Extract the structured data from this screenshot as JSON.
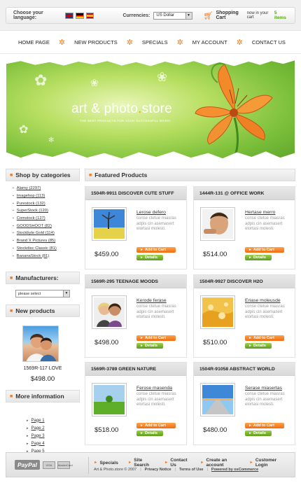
{
  "topbar": {
    "language_label": "Choose your language:",
    "languages": [
      "english-flag",
      "german-flag",
      "spanish-flag"
    ],
    "currency_label": "Currencies:",
    "currency_value": "US Dollar",
    "cart_label": "Shopping Cart",
    "cart_text": "now in your cart",
    "cart_count": "5 items"
  },
  "nav": {
    "items": [
      "HOME PAGE",
      "NEW PRODUCTS",
      "SPECIALS",
      "MY ACCOUNT",
      "CONTACT US"
    ]
  },
  "banner": {
    "title_part1": "art & photo",
    "title_dot": ".",
    "title_part2": "store",
    "subtitle": "THE BEST PRODUCTS FOR YOUR SUCCESSFUL WORK!"
  },
  "sidebar": {
    "categories_title": "Shop by categories",
    "categories": [
      "Alamy (2297)",
      "Imagehop (113)",
      "Purestock (132)",
      "SuperStock (120)",
      "Comstock (127)",
      "GOODSHOOT (82)",
      "Stockbyte Gold (114)",
      "Brand X Pictures (85)",
      "Stockdisc Classic (81)",
      "BananaStock (81)"
    ],
    "manufacturers_title": "Manufacturers:",
    "manufacturers_select": "please select",
    "new_products_title": "New products",
    "new_product_name": "1569R-117 LOVE",
    "new_product_price": "$498.00",
    "more_info_title": "More information",
    "pages": [
      "Page 1",
      "Page 2",
      "Page 3",
      "Page 4",
      "Page 5"
    ]
  },
  "featured": {
    "title": "Featured Products",
    "add_label": "Add to Cart",
    "details_label": "Details",
    "products": [
      {
        "title": "1504R-9911 DISCOVER CUTE STUFF",
        "name": "Lerose defero",
        "desc": "conse ctetue miasras adpis cin asemasert elortasi molesti.",
        "price": "$459.00"
      },
      {
        "title": "1444R-131 @ OFFICE WORK",
        "name": "Hertase merro",
        "desc": "conse ctetue miasras adpis cin asemasert elortasi molesti.",
        "price": "$514.00"
      },
      {
        "title": "1569R-295 TEENAGE MOODS",
        "name": "Kerode ferase",
        "desc": "conse ctetue miasras adpis cin asemasert elortasi molesti.",
        "price": "$498.00"
      },
      {
        "title": "1504R-9927 DISCOVER H2O",
        "name": "Eriase moleusde",
        "desc": "conse ctetue miasras adpis cin asemasert elortasi molesti.",
        "price": "$510.00"
      },
      {
        "title": "1569R-3789 GREEN NATURE",
        "name": "Ferose masenda",
        "desc": "conse ctetue miasras adpis cin asemasert elortasi molesti.",
        "price": "$518.00"
      },
      {
        "title": "1504R-91058 ABSTRACT WORLD",
        "name": "Serase miasertas",
        "desc": "conse ctetue miasras adpis cin asemasert elortasi molesti.",
        "price": "$480.00"
      }
    ]
  },
  "footer": {
    "paypal": "PayPal",
    "card1": "VISA",
    "card2": "MasterCard",
    "links": [
      "Specials",
      "Site Search",
      "Contact Us",
      "Create an account",
      "Customer Login"
    ],
    "copyright": "Art & Photo.store © 2007",
    "privacy": "Privacy Notice",
    "terms": "Terms of Use",
    "powered": "Powered by osCommerce"
  },
  "colors": {
    "accent_orange": "#f07a1c",
    "accent_green": "#5aa31a"
  }
}
